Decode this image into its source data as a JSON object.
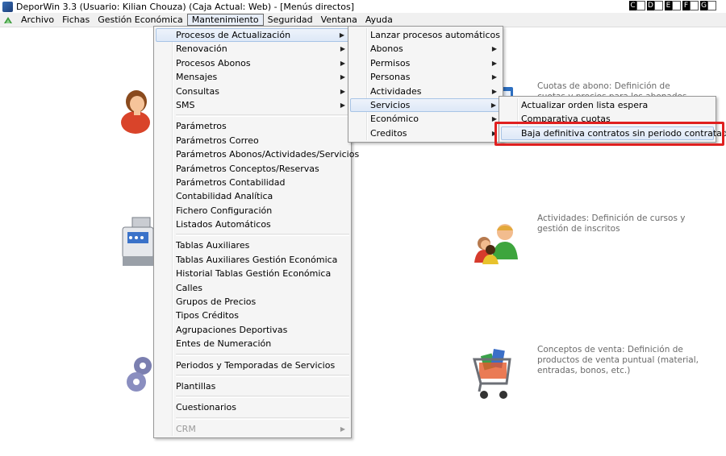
{
  "titlebar": {
    "title": "DeporWin 3.3  (Usuario: Kilian Chouza)  (Caja Actual: Web) - [Menús directos]",
    "buttons": [
      "C",
      "D",
      "E",
      "F",
      "G"
    ]
  },
  "menubar": {
    "items": [
      "Archivo",
      "Fichas",
      "Gestión Económica",
      "Mantenimiento",
      "Seguridad",
      "Ventana",
      "Ayuda"
    ]
  },
  "mantenimiento_menu": {
    "group1": [
      {
        "label": "Procesos de Actualización",
        "submenu": true
      },
      {
        "label": "Renovación",
        "submenu": true
      },
      {
        "label": "Procesos Abonos",
        "submenu": true
      },
      {
        "label": "Mensajes",
        "submenu": true
      },
      {
        "label": "Consultas",
        "submenu": true
      },
      {
        "label": "SMS",
        "submenu": true
      }
    ],
    "group2": [
      "Parámetros",
      "Parámetros Correo",
      "Parámetros Abonos/Actividades/Servicios",
      "Parámetros Conceptos/Reservas",
      "Parámetros Contabilidad",
      "Contabilidad Analítica",
      "Fichero Configuración",
      "Listados Automáticos"
    ],
    "group3": [
      "Tablas Auxiliares",
      "Tablas Auxiliares Gestión Económica",
      "Historial Tablas Gestión Económica",
      "Calles",
      "Grupos de Precios",
      "Tipos Créditos",
      "Agrupaciones Deportivas",
      "Entes de Numeración"
    ],
    "group4": [
      "Periodos y Temporadas de Servicios"
    ],
    "group5": [
      "Plantillas"
    ],
    "group6": [
      "Cuestionarios"
    ],
    "group7": [
      {
        "label": "CRM",
        "submenu": true
      }
    ]
  },
  "procesos_menu": {
    "items": [
      {
        "label": "Lanzar procesos automáticos",
        "submenu": false
      },
      {
        "label": "Abonos",
        "submenu": true
      },
      {
        "label": "Permisos",
        "submenu": true
      },
      {
        "label": "Personas",
        "submenu": true
      },
      {
        "label": "Actividades",
        "submenu": true
      },
      {
        "label": "Servicios",
        "submenu": true
      },
      {
        "label": "Económico",
        "submenu": true
      },
      {
        "label": "Creditos",
        "submenu": true
      }
    ]
  },
  "servicios_menu": {
    "items": [
      "Actualizar orden lista espera",
      "Comparativa cuotas",
      "Baja definitiva contratos sin periodo contratado"
    ]
  },
  "background": {
    "cuotas_line1": "Cuotas de abono: Definición de",
    "cuotas_line2": "cuotas y precios para los abonados",
    "actividades_line1": "Actividades: Definición de cursos y",
    "actividades_line2": "gestión de inscritos",
    "conceptos_line1": "Conceptos de venta: Definición de",
    "conceptos_line2": "productos de venta puntual (material,",
    "conceptos_line3": "entradas, bonos, etc.)"
  },
  "colors": {
    "highlight_border": "#a8c4e6",
    "annotation_red": "#e02020"
  }
}
